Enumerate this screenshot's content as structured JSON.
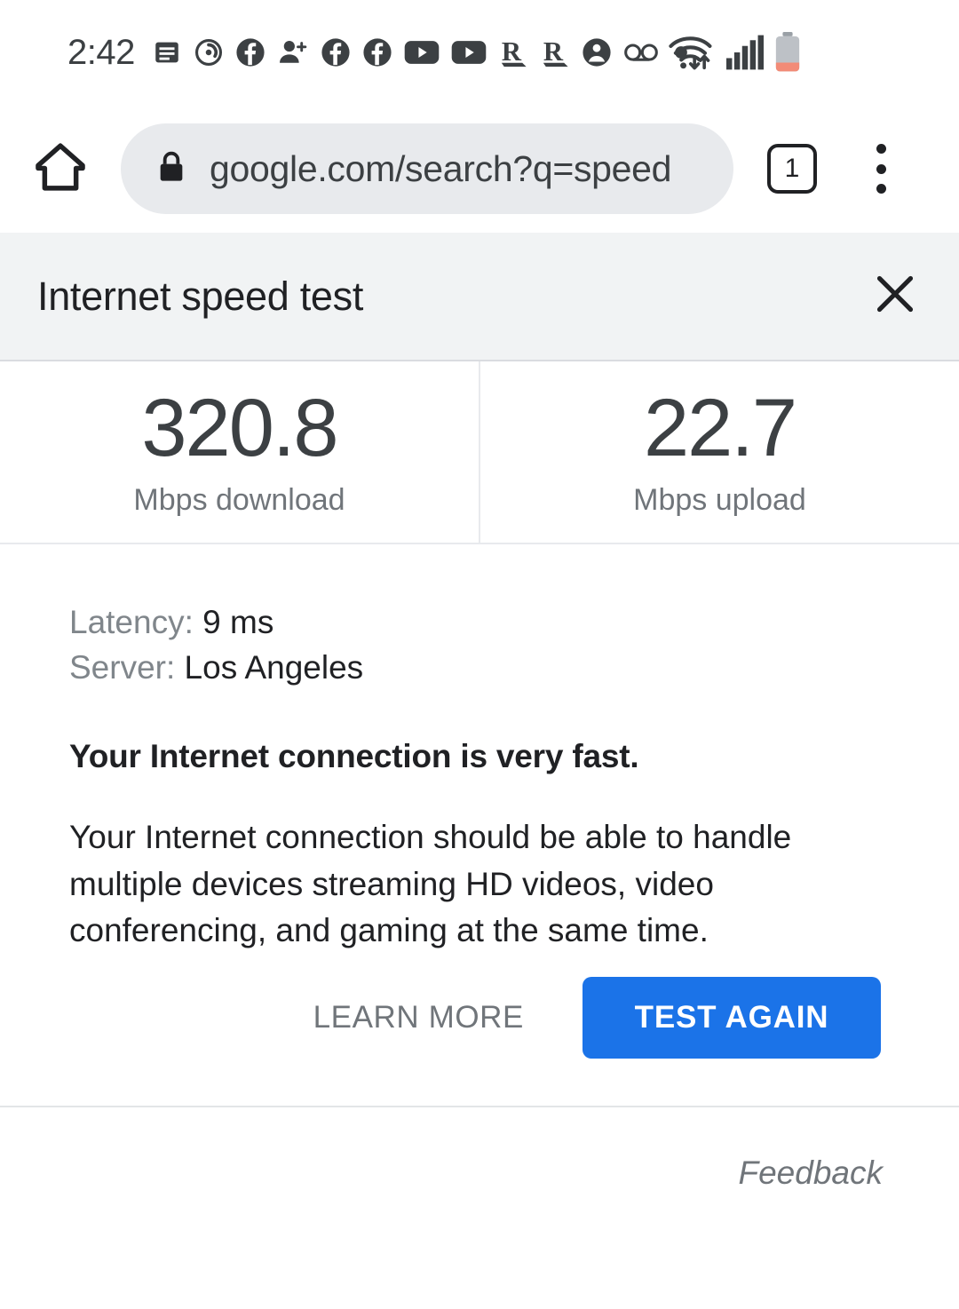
{
  "status_bar": {
    "time": "2:42",
    "icons": [
      "message-icon",
      "sync-circle-icon",
      "facebook-icon",
      "add-person-icon",
      "facebook-icon",
      "facebook-icon",
      "youtube-icon",
      "youtube-icon",
      "reddit-r-icon",
      "reddit-r-icon",
      "account-circle-icon",
      "voicemail-icon",
      "dot-icon"
    ],
    "right_icons": [
      "wifi-transfer-icon",
      "cellular-signal-icon",
      "battery-low-icon"
    ],
    "battery_color": "#f28b77"
  },
  "browser": {
    "home_icon": "home-icon",
    "lock_icon": "lock-icon",
    "url": "google.com/search?q=speed",
    "tab_count": "1",
    "menu_icon": "overflow-menu-icon"
  },
  "speed_test": {
    "title": "Internet speed test",
    "close_icon": "close-icon",
    "results": [
      {
        "value": "320.8",
        "label": "Mbps download"
      },
      {
        "value": "22.7",
        "label": "Mbps upload"
      }
    ],
    "details": [
      {
        "key": "Latency:",
        "value": "9 ms"
      },
      {
        "key": "Server:",
        "value": "Los Angeles"
      }
    ],
    "summary": "Your Internet connection is very fast.",
    "description": "Your Internet connection should be able to handle multiple devices streaming HD videos, video conferencing, and gaming at the same time.",
    "actions": {
      "secondary_label": "LEARN MORE",
      "primary_label": "TEST AGAIN",
      "primary_color": "#1b73e8"
    },
    "feedback_label": "Feedback"
  }
}
